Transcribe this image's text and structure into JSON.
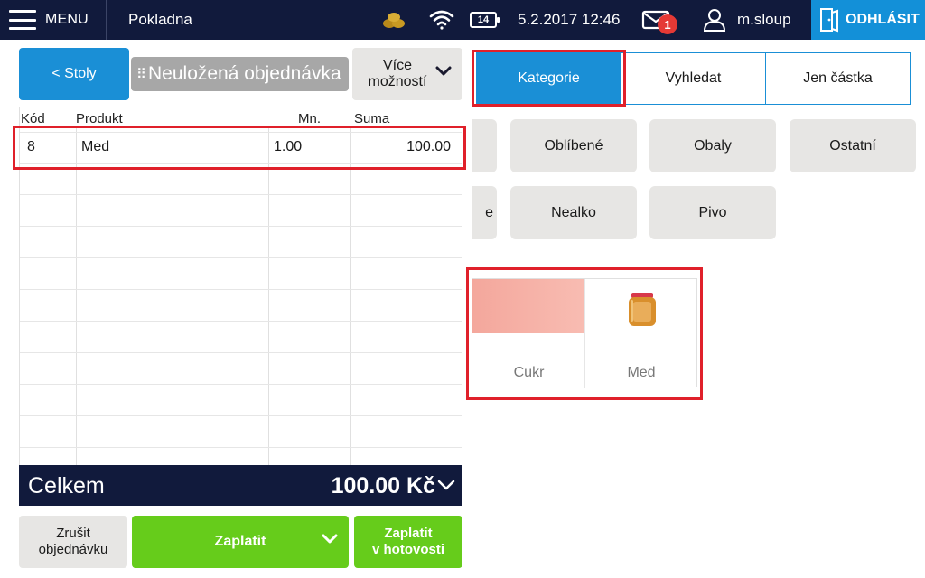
{
  "topbar": {
    "menu_label": "MENU",
    "title": "Pokladna",
    "battery": "14",
    "datetime": "5.2.2017 12:46",
    "mail_count": "1",
    "username": "m.sloup",
    "logout_label": "ODHLÁSIT"
  },
  "order": {
    "back_label": "< Stoly",
    "name": "Neuložená objednávka",
    "more_label_line1": "Více",
    "more_label_line2": "možností",
    "columns": {
      "code": "Kód",
      "product": "Produkt",
      "qty": "Mn.",
      "sum": "Suma"
    },
    "items": [
      {
        "code": "8",
        "product": "Med",
        "qty": "1.00",
        "sum": "100.00"
      }
    ],
    "total_label": "Celkem",
    "total_value": "100.00 Kč",
    "cancel_label_line1": "Zrušit",
    "cancel_label_line2": "objednávku",
    "pay_label": "Zaplatit",
    "pay_cash_line1": "Zaplatit",
    "pay_cash_line2": "v hotovosti"
  },
  "tabs": [
    {
      "label": "Kategorie",
      "active": true
    },
    {
      "label": "Vyhledat",
      "active": false
    },
    {
      "label": "Jen částka",
      "active": false
    }
  ],
  "categories": {
    "row1_partial": "",
    "row1": [
      "Oblíbené",
      "Obaly",
      "Ostatní"
    ],
    "row2_partial": "e",
    "row2": [
      "Nealko",
      "Pivo"
    ]
  },
  "products": [
    {
      "label": "Cukr",
      "icon": "color-swatch"
    },
    {
      "label": "Med",
      "icon": "honey-jar-icon"
    }
  ],
  "colors": {
    "topbar": "#111a3c",
    "accent_blue": "#1a8fd6",
    "pay_green": "#66cc1b",
    "highlight_red": "#e0202a",
    "badge_red": "#e53935"
  }
}
